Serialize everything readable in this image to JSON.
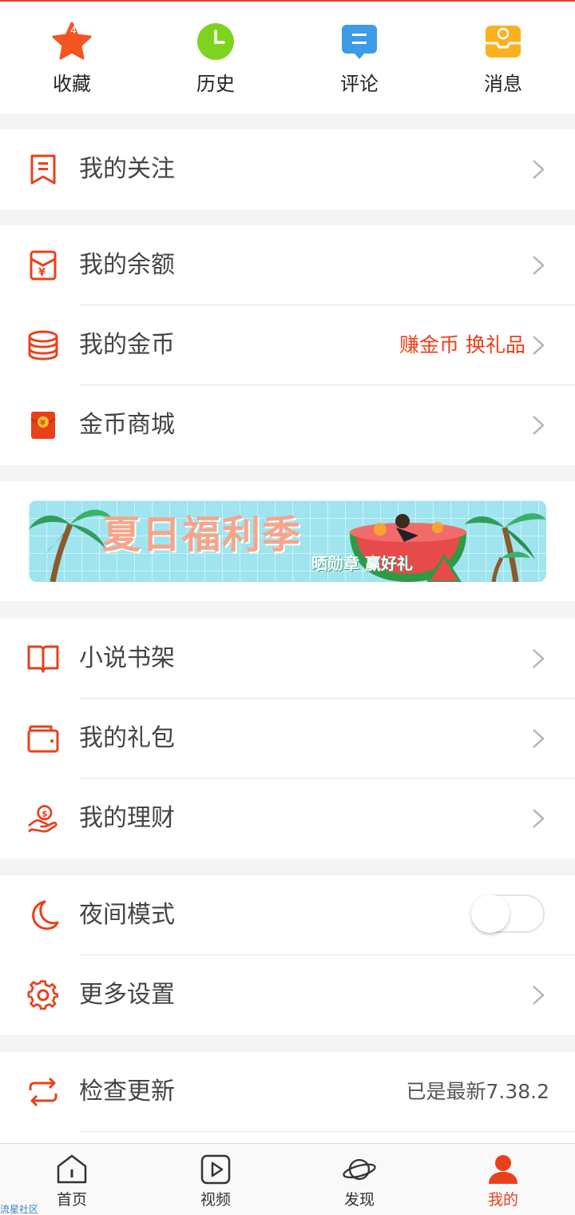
{
  "accent_color": "#e9401c",
  "quick_actions": [
    {
      "label": "收藏",
      "icon": "star-icon",
      "badge": "4",
      "color": "#f4541f"
    },
    {
      "label": "历史",
      "icon": "clock-icon",
      "color": "#7ed321"
    },
    {
      "label": "评论",
      "icon": "comment-icon",
      "color": "#3d9ce7"
    },
    {
      "label": "消息",
      "icon": "message-box-icon",
      "color": "#fbb11f"
    }
  ],
  "menu": {
    "follow": {
      "label": "我的关注",
      "icon": "bookmark-icon"
    },
    "balance": {
      "label": "我的余额",
      "icon": "wallet-yen-icon"
    },
    "coins": {
      "label": "我的金币",
      "icon": "coin-stack-icon",
      "extra": "赚金币 换礼品"
    },
    "coin_mall": {
      "label": "金币商城",
      "icon": "red-envelope-icon"
    },
    "bookshelf": {
      "label": "小说书架",
      "icon": "book-icon"
    },
    "gifts": {
      "label": "我的礼包",
      "icon": "gift-wallet-icon"
    },
    "finance": {
      "label": "我的理财",
      "icon": "hand-coin-icon"
    },
    "night_mode": {
      "label": "夜间模式",
      "icon": "moon-icon",
      "enabled": false
    },
    "settings": {
      "label": "更多设置",
      "icon": "gear-icon"
    },
    "update": {
      "label": "检查更新",
      "icon": "refresh-icon",
      "extra": "已是最新7.38.2"
    }
  },
  "banner": {
    "title": "夏日福利季",
    "subtitle": "晒勋章 赢好礼"
  },
  "tabbar": [
    {
      "label": "首页",
      "icon": "home-icon",
      "active": false
    },
    {
      "label": "视频",
      "icon": "video-play-icon",
      "active": false
    },
    {
      "label": "发现",
      "icon": "planet-icon",
      "active": false
    },
    {
      "label": "我的",
      "icon": "user-icon",
      "active": true
    }
  ],
  "watermark": "流星社区"
}
